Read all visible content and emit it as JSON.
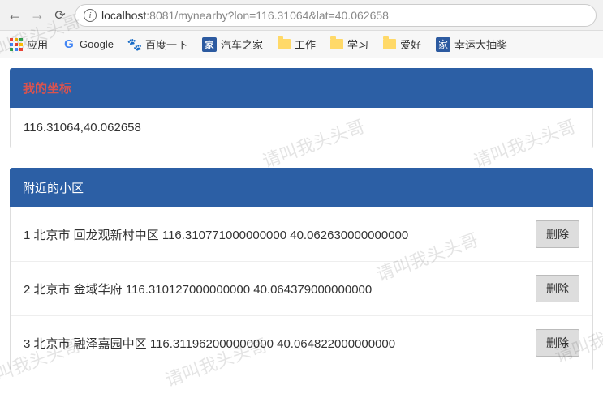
{
  "browser": {
    "url_host": "localhost",
    "url_rest": ":8081/mynearby?lon=116.31064&lat=40.062658"
  },
  "bookmarks": {
    "apps": "应用",
    "google": "Google",
    "baidu": "百度一下",
    "autohome": "汽车之家",
    "work": "工作",
    "study": "学习",
    "hobby": "爱好",
    "lottery": "幸运大抽奖"
  },
  "autohome_icon_text": "家",
  "lottery_icon_text": "家",
  "sections": {
    "coord_title": "我的坐标",
    "coord_value": "116.31064,40.062658",
    "nearby_title": "附近的小区"
  },
  "items": [
    {
      "idx": "1",
      "city": "北京市",
      "name": "回龙观新村中区",
      "lon": "116.310771000000000",
      "lat": "40.062630000000000"
    },
    {
      "idx": "2",
      "city": "北京市",
      "name": "金域华府",
      "lon": "116.310127000000000",
      "lat": "40.064379000000000"
    },
    {
      "idx": "3",
      "city": "北京市",
      "name": "融泽嘉园中区",
      "lon": "116.311962000000000",
      "lat": "40.064822000000000"
    }
  ],
  "delete_label": "删除",
  "watermark_text": "请叫我头头哥"
}
